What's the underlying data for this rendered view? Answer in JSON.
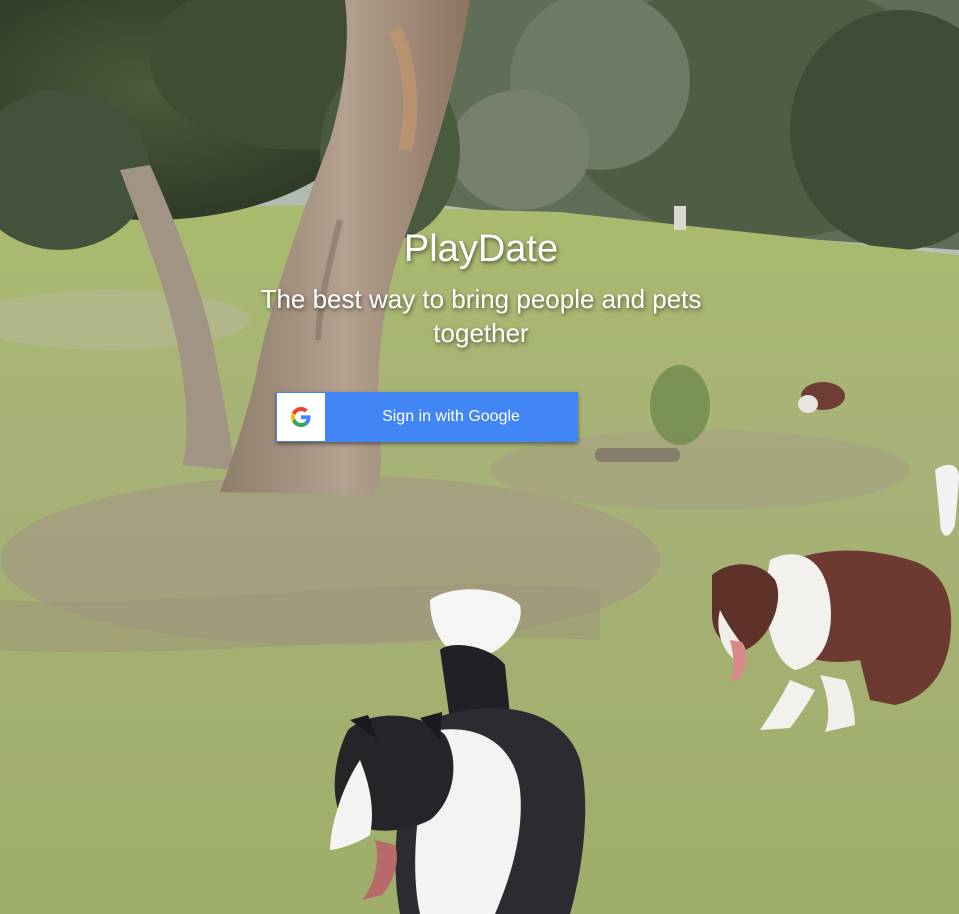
{
  "hero": {
    "title": "PlayDate",
    "subtitle": "The best way to bring people and pets together"
  },
  "signin": {
    "label": "Sign in with Google",
    "icon": "google-g-icon",
    "color": "#4285f4"
  }
}
